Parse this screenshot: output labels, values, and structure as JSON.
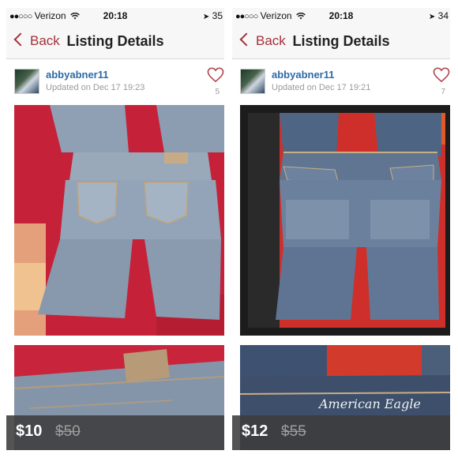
{
  "screens": [
    {
      "status": {
        "carrier": "Verizon",
        "time": "20:18",
        "battery": "35"
      },
      "nav": {
        "back_label": "Back",
        "title": "Listing Details"
      },
      "seller": {
        "username": "abbyabner11",
        "updated": "Updated on Dec 17 19:23"
      },
      "likes": "5",
      "price": "$10",
      "original_price": "$50"
    },
    {
      "status": {
        "carrier": "Verizon",
        "time": "20:18",
        "battery": "34"
      },
      "nav": {
        "back_label": "Back",
        "title": "Listing Details"
      },
      "seller": {
        "username": "abbyabner11",
        "updated": "Updated on Dec 17 19:21"
      },
      "likes": "7",
      "price": "$12",
      "original_price": "$55",
      "photo_text": {
        "brand_embroidery": "American Eagle"
      }
    }
  ],
  "colors": {
    "accent": "#a3313a",
    "link": "#2c6aa6",
    "price_bar": "#3c3c3c"
  },
  "icons": [
    "signal-dots-icon",
    "wifi-icon",
    "location-arrow-icon",
    "back-chevron-icon",
    "heart-icon"
  ]
}
